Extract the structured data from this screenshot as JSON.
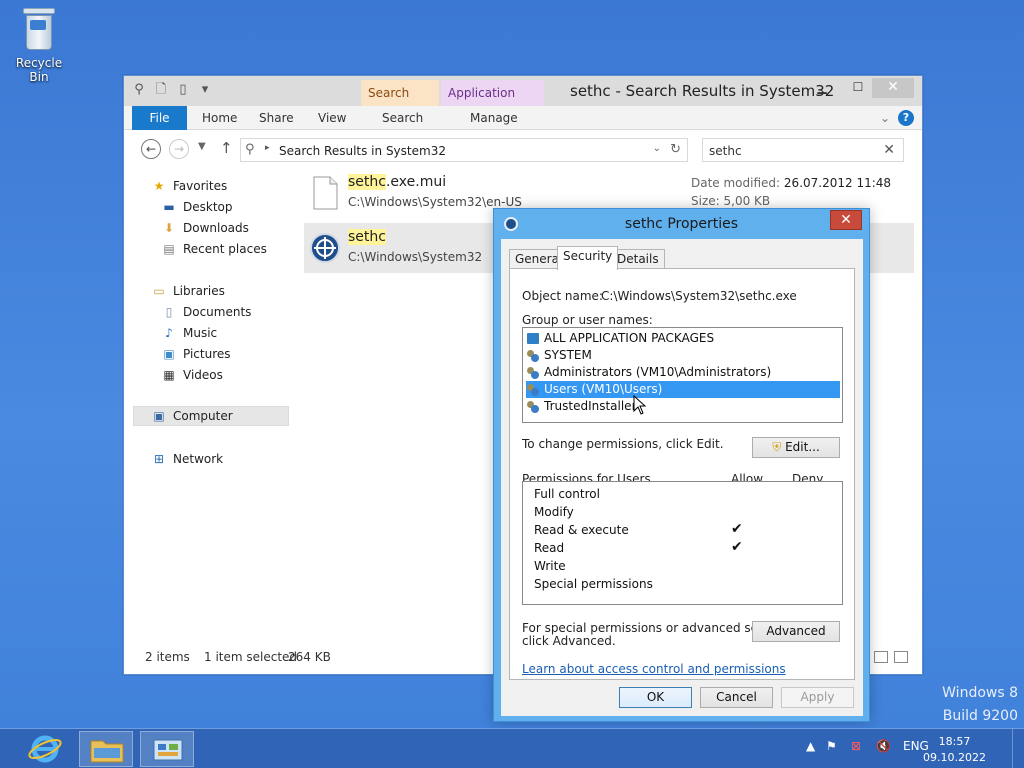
{
  "desktop": {
    "recycle_bin_label": "Recycle Bin",
    "watermark_line1": "Windows 8",
    "watermark_line2": "Build 9200"
  },
  "explorer": {
    "title": "sethc - Search Results in System32",
    "context_tabs": [
      "Search Tools",
      "Application Tools"
    ],
    "ribbon": {
      "file": "File",
      "home": "Home",
      "share": "Share",
      "view": "View",
      "search": "Search",
      "manage": "Manage"
    },
    "address": "Search Results in System32",
    "search_value": "sethc",
    "nav": {
      "favorites": "Favorites",
      "desktop": "Desktop",
      "downloads": "Downloads",
      "recent": "Recent places",
      "libraries": "Libraries",
      "documents": "Documents",
      "music": "Music",
      "pictures": "Pictures",
      "videos": "Videos",
      "computer": "Computer",
      "network": "Network"
    },
    "items": [
      {
        "name_hl": "sethc",
        "name_rest": ".exe.mui",
        "path": "C:\\Windows\\System32\\en-US",
        "date_label": "Date modified:",
        "date_value": "26.07.2012 11:48",
        "size_text": "Size: 5,00 KB"
      },
      {
        "name_hl": "sethc",
        "name_rest": "",
        "path": "C:\\Windows\\System32"
      }
    ],
    "status": {
      "count": "2 items",
      "selected": "1 item selected",
      "size": "264 KB"
    }
  },
  "props": {
    "title": "sethc Properties",
    "tabs": [
      "General",
      "Security",
      "Details"
    ],
    "object_label": "Object name:",
    "object_value": "C:\\Windows\\System32\\sethc.exe",
    "group_label": "Group or user names:",
    "groups": [
      "ALL APPLICATION PACKAGES",
      "SYSTEM",
      "Administrators (VM10\\Administrators)",
      "Users (VM10\\Users)",
      "TrustedInstaller"
    ],
    "change_text": "To change permissions, click Edit.",
    "edit_button": "Edit...",
    "perm_label": "Permissions for Users",
    "allow": "Allow",
    "deny": "Deny",
    "permissions": [
      {
        "name": "Full control",
        "allow": ""
      },
      {
        "name": "Modify",
        "allow": ""
      },
      {
        "name": "Read & execute",
        "allow": "✔"
      },
      {
        "name": "Read",
        "allow": "✔"
      },
      {
        "name": "Write",
        "allow": ""
      },
      {
        "name": "Special permissions",
        "allow": ""
      }
    ],
    "special_line1": "For special permissions or advanced settings,",
    "special_line2": "click Advanced.",
    "advanced_button": "Advanced",
    "learn_link": "Learn about access control and permissions",
    "ok": "OK",
    "cancel": "Cancel",
    "apply": "Apply"
  },
  "taskbar": {
    "lang": "ENG",
    "time": "18:57",
    "date": "09.10.2022"
  },
  "colors": {
    "selection": "#3498f2",
    "file_tab": "#1979ca",
    "search_hl": "#fff49a"
  }
}
